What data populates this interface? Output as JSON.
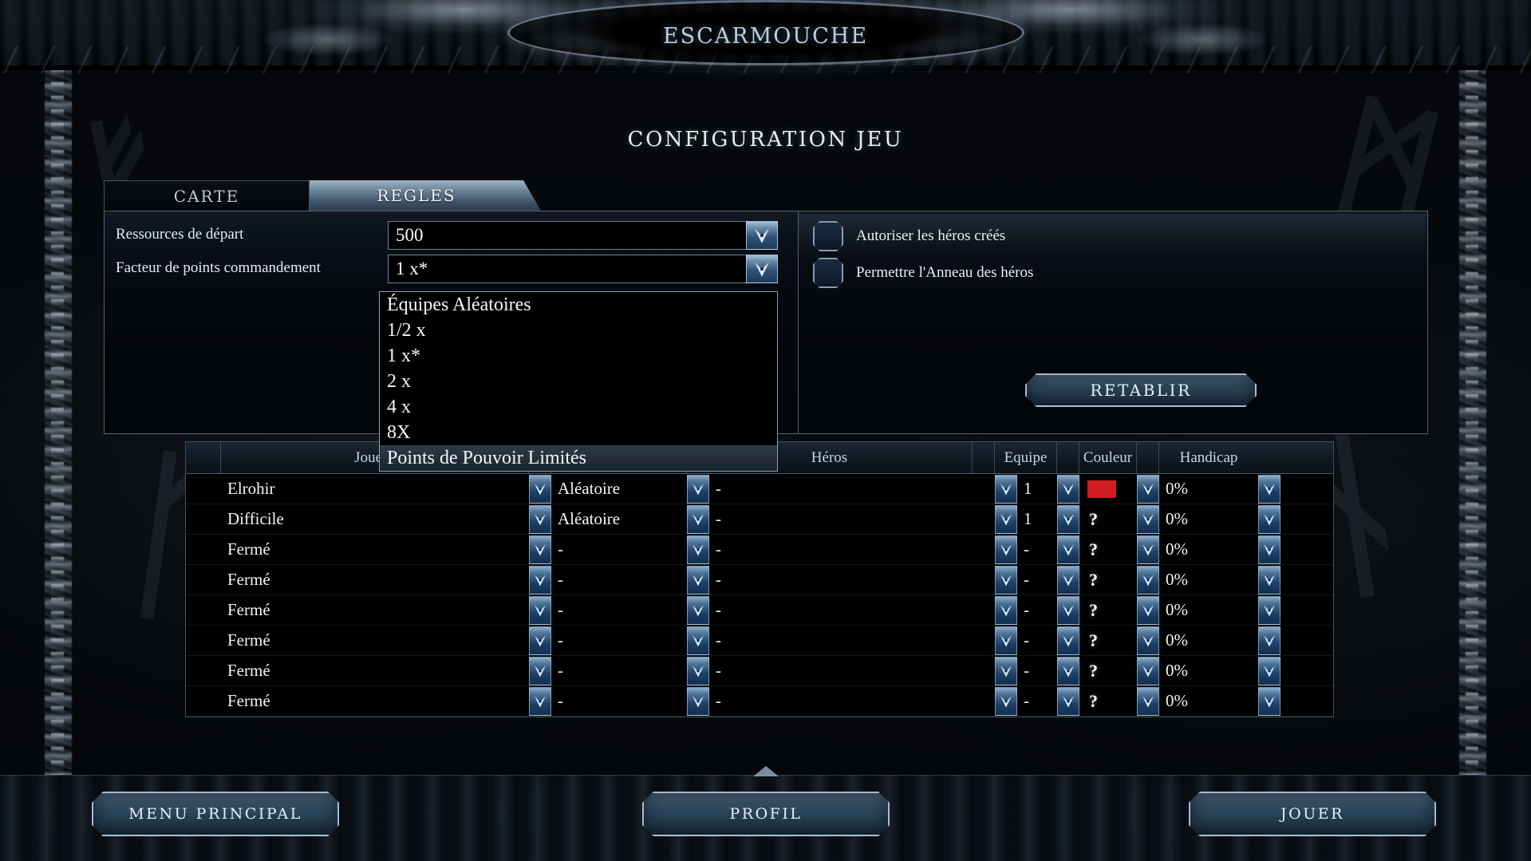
{
  "window": {
    "title": "escarmouche"
  },
  "heading": "CONFIGURATION JEU",
  "tabs": [
    {
      "label": "CARTE",
      "active": false
    },
    {
      "label": "REGLES",
      "active": true
    }
  ],
  "settings": {
    "rows": [
      {
        "label": "Ressources de départ",
        "value": "500"
      },
      {
        "label": "Facteur de points commandement",
        "value": "1 x*"
      }
    ]
  },
  "dropdown": {
    "open": true,
    "selected": "1 x*",
    "options": [
      "Équipes Aléatoires",
      "1/2 x",
      "1 x*",
      "2 x",
      "4 x",
      "8X",
      "Points de Pouvoir Limités"
    ]
  },
  "options": {
    "checkboxes": [
      {
        "label": "Autoriser les héros créés",
        "checked": false
      },
      {
        "label": "Permettre l'Anneau des héros",
        "checked": false
      }
    ],
    "reset_label": "RETABLIR"
  },
  "players_table": {
    "columns": [
      "",
      "Joueur",
      "",
      "",
      "Héros",
      "",
      "Equipe",
      "",
      "Couleur",
      "",
      "Handicap",
      ""
    ],
    "headers": {
      "joueur": "Joueur",
      "heros": "Héros",
      "equipe": "Equipe",
      "couleur": "Couleur",
      "handicap": "Handicap"
    },
    "rows": [
      {
        "joueur": "Elrohir",
        "heros": "Aléatoire",
        "hero_detail": "-",
        "equipe": "1",
        "couleur": "#d21c20",
        "couleur_label": "",
        "handicap": "0%"
      },
      {
        "joueur": "Difficile",
        "heros": "Aléatoire",
        "hero_detail": "-",
        "equipe": "1",
        "couleur": "",
        "couleur_label": "?",
        "handicap": "0%"
      },
      {
        "joueur": "Fermé",
        "heros": "-",
        "hero_detail": "-",
        "equipe": "-",
        "couleur": "",
        "couleur_label": "?",
        "handicap": "0%"
      },
      {
        "joueur": "Fermé",
        "heros": "-",
        "hero_detail": "-",
        "equipe": "-",
        "couleur": "",
        "couleur_label": "?",
        "handicap": "0%"
      },
      {
        "joueur": "Fermé",
        "heros": "-",
        "hero_detail": "-",
        "equipe": "-",
        "couleur": "",
        "couleur_label": "?",
        "handicap": "0%"
      },
      {
        "joueur": "Fermé",
        "heros": "-",
        "hero_detail": "-",
        "equipe": "-",
        "couleur": "",
        "couleur_label": "?",
        "handicap": "0%"
      },
      {
        "joueur": "Fermé",
        "heros": "-",
        "hero_detail": "-",
        "equipe": "-",
        "couleur": "",
        "couleur_label": "?",
        "handicap": "0%"
      },
      {
        "joueur": "Fermé",
        "heros": "-",
        "hero_detail": "-",
        "equipe": "-",
        "couleur": "",
        "couleur_label": "?",
        "handicap": "0%"
      }
    ]
  },
  "bottom_buttons": {
    "main_menu": "MENU PRINCIPAL",
    "profile": "PROFIL",
    "play": "JOUER"
  },
  "colors": {
    "accent": "#a8c1d6",
    "panel_border": "#8ca8c0",
    "text": "#e8edf2",
    "red_swatch": "#d21c20"
  },
  "icons": {
    "dropdown_arrow": "chevron-down-icon"
  }
}
